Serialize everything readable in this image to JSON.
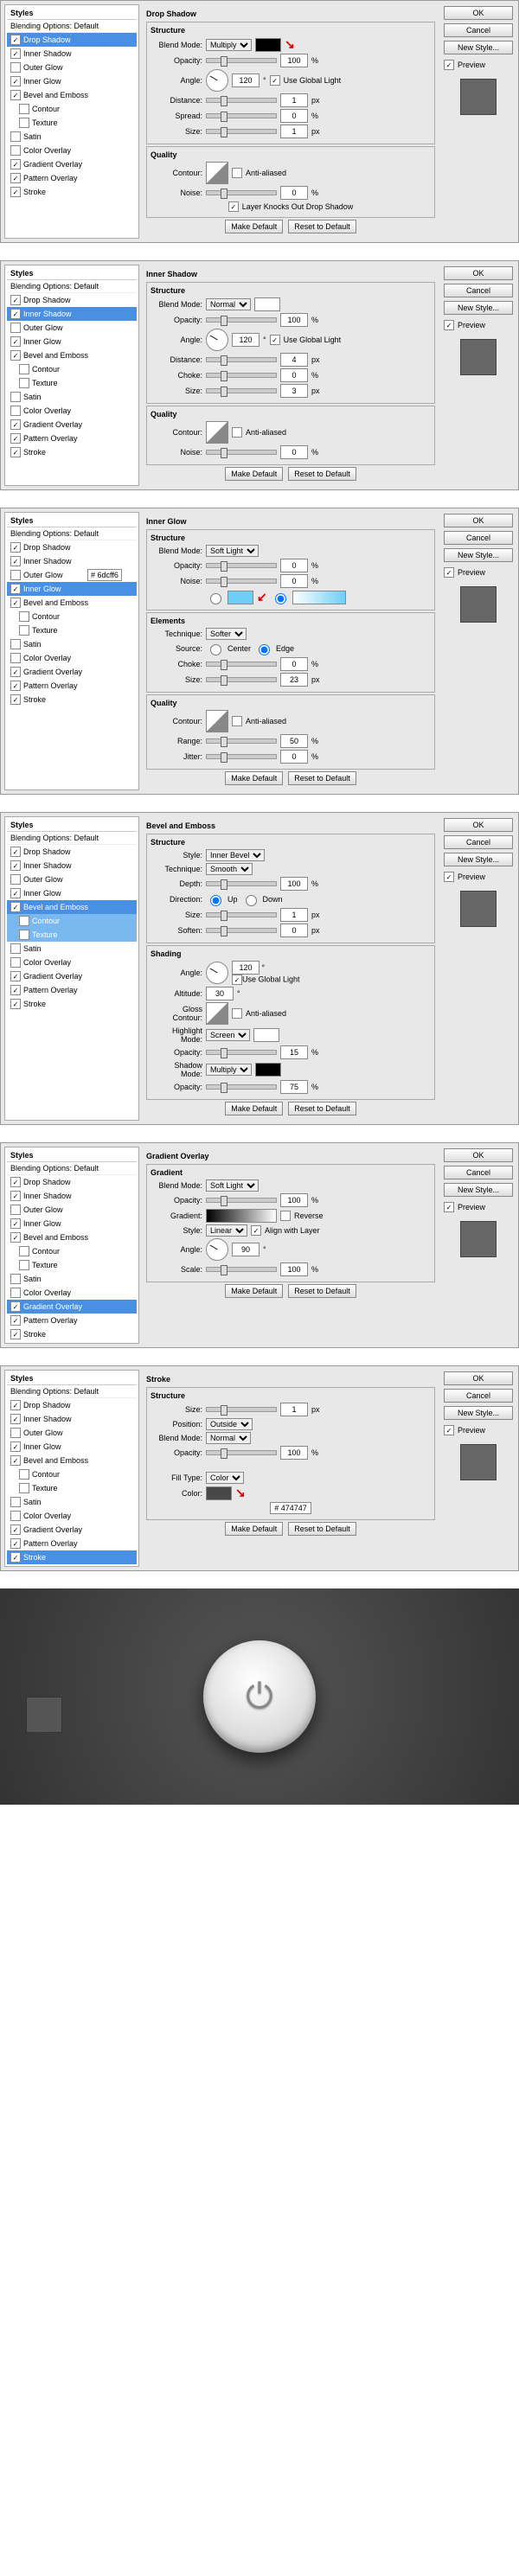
{
  "styles_header": "Styles",
  "blending_opts": "Blending Options: Default",
  "style_names": {
    "drop_shadow": "Drop Shadow",
    "inner_shadow": "Inner Shadow",
    "outer_glow": "Outer Glow",
    "inner_glow": "Inner Glow",
    "bevel_emboss": "Bevel and Emboss",
    "contour": "Contour",
    "texture": "Texture",
    "satin": "Satin",
    "color_overlay": "Color Overlay",
    "gradient_overlay": "Gradient Overlay",
    "pattern_overlay": "Pattern Overlay",
    "stroke": "Stroke"
  },
  "btns": {
    "ok": "OK",
    "cancel": "Cancel",
    "new_style": "New Style...",
    "make_default": "Make Default",
    "reset_default": "Reset to Default"
  },
  "preview_label": "Preview",
  "labels": {
    "structure": "Structure",
    "quality": "Quality",
    "blend_mode": "Blend Mode:",
    "opacity": "Opacity:",
    "angle": "Angle:",
    "use_global": "Use Global Light",
    "distance": "Distance:",
    "spread": "Spread:",
    "size": "Size:",
    "choke": "Choke:",
    "contour": "Contour:",
    "anti_aliased": "Anti-aliased",
    "noise": "Noise:",
    "layer_knocks": "Layer Knocks Out Drop Shadow",
    "elements": "Elements",
    "technique": "Technique:",
    "source": "Source:",
    "center": "Center",
    "edge": "Edge",
    "range": "Range:",
    "jitter": "Jitter:",
    "style": "Style:",
    "depth": "Depth:",
    "direction": "Direction:",
    "up": "Up",
    "down": "Down",
    "soften": "Soften:",
    "shading": "Shading",
    "altitude": "Altitude:",
    "gloss_contour": "Gloss Contour:",
    "highlight_mode": "Highlight Mode:",
    "shadow_mode": "Shadow Mode:",
    "gradient": "Gradient",
    "gradient_lbl": "Gradient:",
    "reverse": "Reverse",
    "align_layer": "Align with Layer",
    "scale": "Scale:",
    "position": "Position:",
    "fill_type": "Fill Type:",
    "color": "Color:",
    "pct": "%",
    "px": "px",
    "deg": "°"
  },
  "panels": [
    {
      "title": "Drop Shadow",
      "active": "drop_shadow",
      "checked": [
        "drop_shadow",
        "inner_shadow",
        "inner_glow",
        "bevel_emboss",
        "gradient_overlay",
        "pattern_overlay",
        "stroke"
      ],
      "vals": {
        "blend_mode": "Multiply",
        "opacity": "100",
        "angle": "120",
        "distance": "1",
        "spread": "0",
        "size": "1",
        "noise": "0"
      }
    },
    {
      "title": "Inner Shadow",
      "active": "inner_shadow",
      "checked": [
        "drop_shadow",
        "inner_shadow",
        "inner_glow",
        "bevel_emboss",
        "gradient_overlay",
        "pattern_overlay",
        "stroke"
      ],
      "vals": {
        "blend_mode": "Normal",
        "opacity": "100",
        "angle": "120",
        "distance": "4",
        "choke": "0",
        "size": "3",
        "noise": "0"
      }
    },
    {
      "title": "Inner Glow",
      "active": "inner_glow",
      "checked": [
        "drop_shadow",
        "inner_shadow",
        "inner_glow",
        "bevel_emboss",
        "gradient_overlay",
        "pattern_overlay",
        "stroke"
      ],
      "hex": "# 6dcff6",
      "vals": {
        "blend_mode": "Soft Light",
        "opacity": "0",
        "noise": "0",
        "technique": "Softer",
        "source": "edge",
        "choke": "0",
        "size": "23",
        "range": "50",
        "jitter": "0"
      }
    },
    {
      "title": "Bevel and Emboss",
      "active": "bevel_emboss",
      "checked": [
        "drop_shadow",
        "inner_shadow",
        "inner_glow",
        "bevel_emboss",
        "gradient_overlay",
        "pattern_overlay",
        "stroke"
      ],
      "sub_active": [
        "contour",
        "texture"
      ],
      "vals": {
        "style": "Inner Bevel",
        "technique": "Smooth",
        "depth": "100",
        "direction": "up",
        "size": "1",
        "soften": "0",
        "angle": "120",
        "altitude": "30",
        "highlight_mode": "Screen",
        "hl_opacity": "15",
        "shadow_mode": "Multiply",
        "sh_opacity": "75"
      }
    },
    {
      "title": "Gradient Overlay",
      "active": "gradient_overlay",
      "checked": [
        "drop_shadow",
        "inner_shadow",
        "inner_glow",
        "bevel_emboss",
        "gradient_overlay",
        "pattern_overlay",
        "stroke"
      ],
      "vals": {
        "blend_mode": "Soft Light",
        "opacity": "100",
        "style": "Linear",
        "angle": "90",
        "scale": "100"
      }
    },
    {
      "title": "Stroke",
      "active": "stroke",
      "checked": [
        "drop_shadow",
        "inner_shadow",
        "inner_glow",
        "bevel_emboss",
        "gradient_overlay",
        "pattern_overlay",
        "stroke"
      ],
      "hex": "# 474747",
      "vals": {
        "size": "1",
        "position": "Outside",
        "blend_mode": "Normal",
        "opacity": "100",
        "fill_type": "Color"
      }
    }
  ]
}
